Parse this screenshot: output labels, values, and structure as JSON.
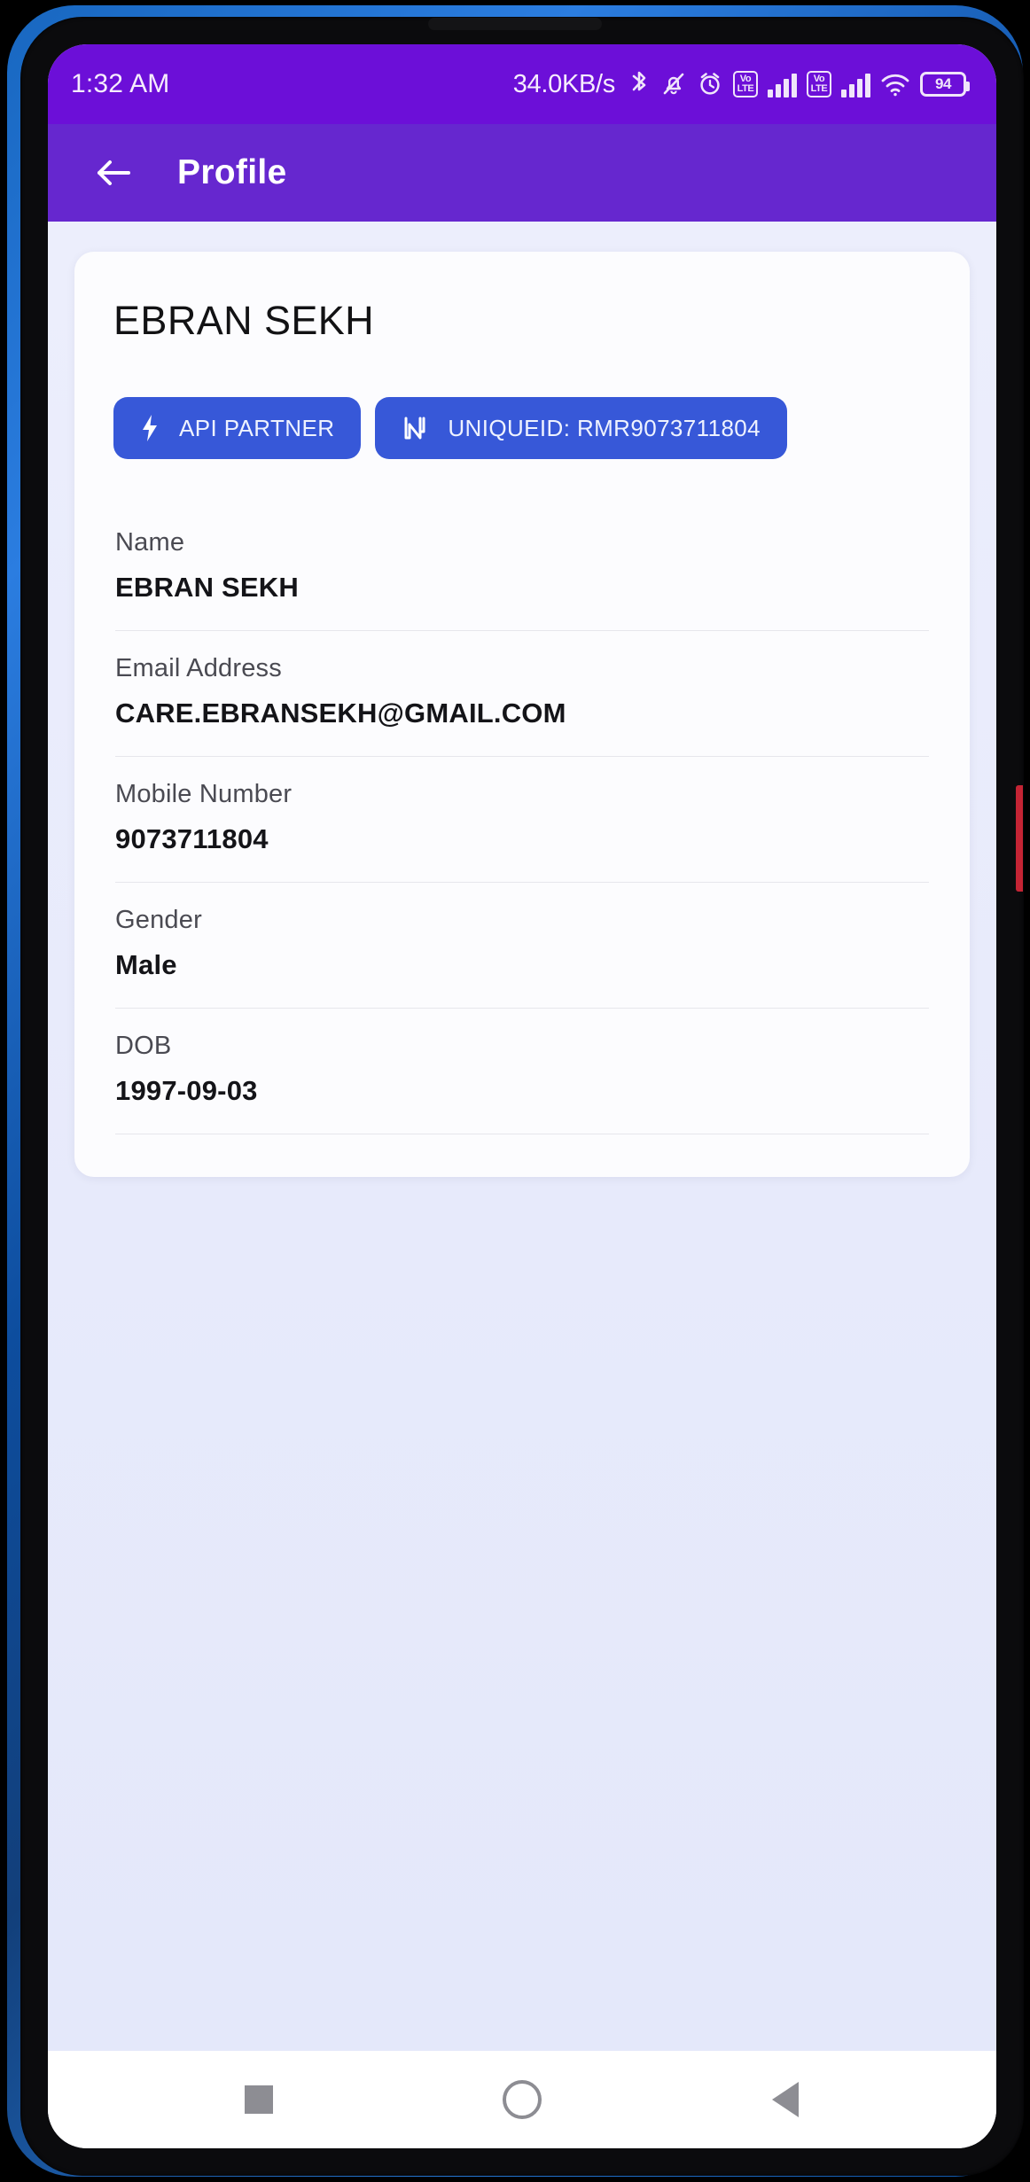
{
  "statusbar": {
    "time": "1:32 AM",
    "network_speed": "34.0KB/s",
    "icons": [
      "bluetooth-icon",
      "notifications-muted-icon",
      "alarm-icon",
      "volte-icon",
      "signal-icon",
      "volte-icon-2",
      "signal-icon-2",
      "wifi-icon",
      "battery-icon"
    ],
    "battery_level": "94",
    "lte_top": "Vo",
    "lte_bottom": "LTE"
  },
  "appbar": {
    "back_label": "back-arrow",
    "title": "Profile"
  },
  "profile": {
    "display_name": "EBRAN SEKH",
    "badges": [
      {
        "label": "API PARTNER",
        "icon": "lightning-bolt-icon"
      },
      {
        "label": "UNIQUEID: RMR9073711804",
        "icon": "id-card-icon"
      }
    ],
    "fields": [
      {
        "label": "Name",
        "value": "EBRAN SEKH"
      },
      {
        "label": "Email Address",
        "value": "CARE.EBRANSEKH@GMAIL.COM"
      },
      {
        "label": "Mobile Number",
        "value": "9073711804"
      },
      {
        "label": "Gender",
        "value": "Male"
      },
      {
        "label": "DOB",
        "value": "1997-09-03"
      }
    ]
  },
  "navbar": {
    "recents": "recents-button",
    "home": "home-button",
    "back": "back-button"
  },
  "colors": {
    "status_purple": "#6c0fd8",
    "appbar_purple": "#6627cf",
    "badge_blue": "#3758d8",
    "page_bg": "#e9ecfb"
  }
}
